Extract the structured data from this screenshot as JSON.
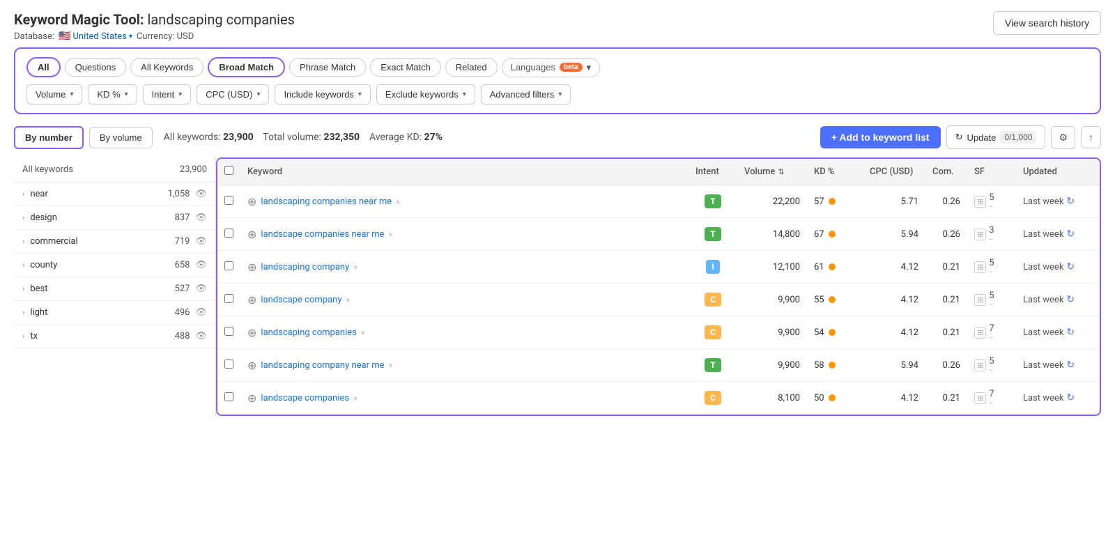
{
  "header": {
    "tool_name": "Keyword Magic Tool:",
    "query": "landscaping companies",
    "view_history_label": "View search history"
  },
  "subtitle": {
    "database_label": "Database:",
    "country": "United States",
    "currency_label": "Currency: USD"
  },
  "tabs": [
    {
      "id": "all",
      "label": "All",
      "active": true
    },
    {
      "id": "questions",
      "label": "Questions",
      "active": false
    },
    {
      "id": "all-keywords",
      "label": "All Keywords",
      "active": false
    },
    {
      "id": "broad-match",
      "label": "Broad Match",
      "active": true
    },
    {
      "id": "phrase-match",
      "label": "Phrase Match",
      "active": false
    },
    {
      "id": "exact-match",
      "label": "Exact Match",
      "active": false
    },
    {
      "id": "related",
      "label": "Related",
      "active": false
    }
  ],
  "languages_btn": "Languages",
  "beta_label": "beta",
  "filters": [
    {
      "id": "volume",
      "label": "Volume"
    },
    {
      "id": "kd",
      "label": "KD %"
    },
    {
      "id": "intent",
      "label": "Intent"
    },
    {
      "id": "cpc",
      "label": "CPC (USD)"
    },
    {
      "id": "include-keywords",
      "label": "Include keywords"
    },
    {
      "id": "exclude-keywords",
      "label": "Exclude keywords"
    },
    {
      "id": "advanced-filters",
      "label": "Advanced filters"
    }
  ],
  "sort_buttons": [
    {
      "id": "by-number",
      "label": "By number",
      "active": true
    },
    {
      "id": "by-volume",
      "label": "By volume",
      "active": false
    }
  ],
  "stats": {
    "all_keywords_label": "All keywords:",
    "all_keywords_value": "23,900",
    "total_volume_label": "Total volume:",
    "total_volume_value": "232,350",
    "avg_kd_label": "Average KD:",
    "avg_kd_value": "27%"
  },
  "add_keyword_btn": "+ Add to keyword list",
  "update_btn": "Update",
  "update_count": "0/1,000",
  "table": {
    "headers": [
      {
        "id": "keyword",
        "label": "Keyword"
      },
      {
        "id": "intent",
        "label": "Intent"
      },
      {
        "id": "volume",
        "label": "Volume"
      },
      {
        "id": "kd",
        "label": "KD %"
      },
      {
        "id": "cpc",
        "label": "CPC (USD)"
      },
      {
        "id": "com",
        "label": "Com."
      },
      {
        "id": "sf",
        "label": "SF"
      },
      {
        "id": "updated",
        "label": "Updated"
      }
    ],
    "rows": [
      {
        "keyword": "landscaping companies near me",
        "intent": "T",
        "volume": "22,200",
        "kd": "57",
        "cpc": "5.71",
        "com": "0.26",
        "sf": "5",
        "updated": "Last week"
      },
      {
        "keyword": "landscape companies near me",
        "intent": "T",
        "volume": "14,800",
        "kd": "67",
        "cpc": "5.94",
        "com": "0.26",
        "sf": "3",
        "updated": "Last week"
      },
      {
        "keyword": "landscaping company",
        "intent": "I",
        "volume": "12,100",
        "kd": "61",
        "cpc": "4.12",
        "com": "0.21",
        "sf": "5",
        "updated": "Last week"
      },
      {
        "keyword": "landscape company",
        "intent": "C",
        "volume": "9,900",
        "kd": "55",
        "cpc": "4.12",
        "com": "0.21",
        "sf": "5",
        "updated": "Last week"
      },
      {
        "keyword": "landscaping companies",
        "intent": "C",
        "volume": "9,900",
        "kd": "54",
        "cpc": "4.12",
        "com": "0.21",
        "sf": "7",
        "updated": "Last week"
      },
      {
        "keyword": "landscaping company near me",
        "intent": "T",
        "volume": "9,900",
        "kd": "58",
        "cpc": "5.94",
        "com": "0.26",
        "sf": "5",
        "updated": "Last week"
      },
      {
        "keyword": "landscape companies",
        "intent": "C",
        "volume": "8,100",
        "kd": "50",
        "cpc": "4.12",
        "com": "0.21",
        "sf": "7",
        "updated": "Last week"
      }
    ]
  },
  "sidebar": {
    "header_keyword": "All keywords",
    "header_count": "23,900",
    "items": [
      {
        "keyword": "near",
        "count": "1,058"
      },
      {
        "keyword": "design",
        "count": "837"
      },
      {
        "keyword": "commercial",
        "count": "719"
      },
      {
        "keyword": "county",
        "count": "658"
      },
      {
        "keyword": "best",
        "count": "527"
      },
      {
        "keyword": "light",
        "count": "496"
      },
      {
        "keyword": "tx",
        "count": "488"
      }
    ]
  }
}
